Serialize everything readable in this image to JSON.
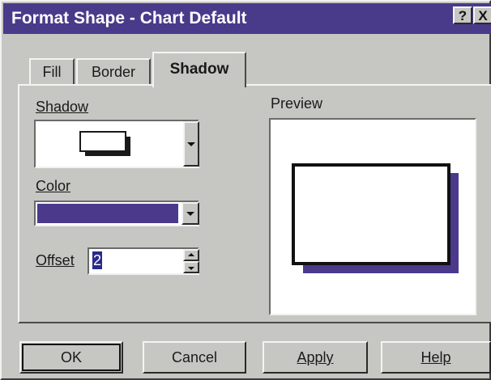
{
  "window": {
    "title": "Format Shape - Chart Default",
    "help_glyph": "?",
    "close_glyph": "X",
    "accent_color": "#4a3a8a"
  },
  "tabs": [
    {
      "label": "Fill",
      "selected": false
    },
    {
      "label": "Border",
      "selected": false
    },
    {
      "label": "Shadow",
      "selected": true
    }
  ],
  "shadow_panel": {
    "shadow_label": "Shadow",
    "color_label": "Color",
    "color_value": "#4b3a8c",
    "offset_label": "Offset",
    "offset_value": "2",
    "preview_label": "Preview"
  },
  "buttons": {
    "ok": "OK",
    "cancel": "Cancel",
    "apply": "Apply",
    "help": "Help"
  }
}
